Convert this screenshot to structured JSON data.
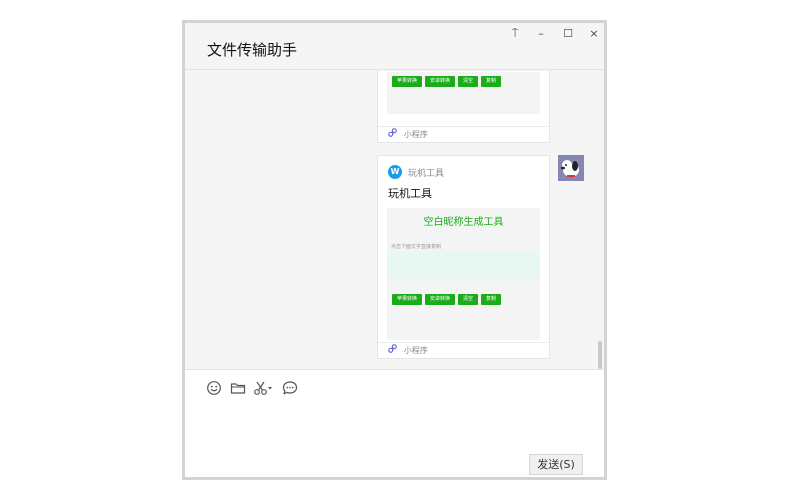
{
  "window": {
    "title": "文件传输助手",
    "controls": {
      "pin": "⍑",
      "minimize": "–",
      "maximize": "☐",
      "close": "×"
    }
  },
  "messages": [
    {
      "type": "mini-program",
      "buttons": [
        "苹果转换",
        "安卓转换",
        "清空",
        "复制"
      ],
      "footer": "小程序"
    },
    {
      "type": "mini-program",
      "app_name": "玩机工具",
      "app_logo": "W",
      "title": "玩机工具",
      "preview_heading": "空白昵称生成工具",
      "preview_hint": "点击下面文字直接复制",
      "buttons": [
        "苹果转换",
        "安卓转换",
        "清空",
        "复制"
      ],
      "footer": "小程序"
    }
  ],
  "toolbar": {
    "icons": [
      "emoji-icon",
      "folder-icon",
      "scissors-icon",
      "chat-history-icon"
    ]
  },
  "send_button": "发送(S)",
  "colors": {
    "accent": "#1aad19",
    "app_logo": "#1b9ee7",
    "preview_box": "#e9f7f3",
    "avatar_bg": "#8686b5"
  }
}
